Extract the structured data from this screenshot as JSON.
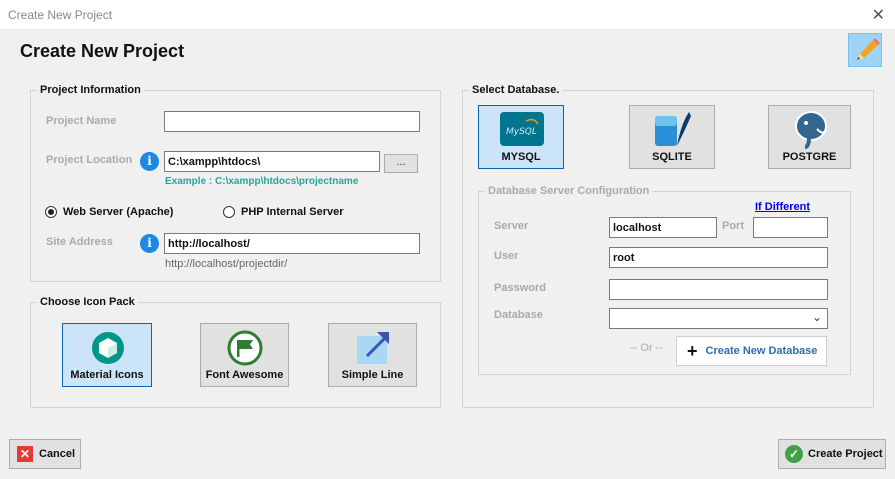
{
  "window": {
    "title": "Create New Project",
    "close_symbol": "✕"
  },
  "header": {
    "title": "Create New Project"
  },
  "project_info": {
    "legend": "Project Information",
    "name_label": "Project Name",
    "name_value": "",
    "location_label": "Project Location",
    "location_value": "C:\\xampp\\htdocs\\",
    "browse_label": "...",
    "location_example": "Example : C:\\xampp\\htdocs\\projectname",
    "info_symbol": "i",
    "server_options": [
      {
        "label": "Web Server (Apache)",
        "selected": true
      },
      {
        "label": "PHP Internal Server",
        "selected": false
      }
    ],
    "site_address_label": "Site Address",
    "site_address_value": "http://localhost/",
    "site_address_hint": "http://localhost/projectdir/"
  },
  "icon_pack": {
    "legend": "Choose Icon Pack",
    "options": [
      {
        "label": "Material Icons",
        "selected": true,
        "icon": "material-icons-icon"
      },
      {
        "label": "Font Awesome",
        "selected": false,
        "icon": "font-awesome-icon"
      },
      {
        "label": "Simple Line",
        "selected": false,
        "icon": "simple-line-icon"
      }
    ]
  },
  "database": {
    "legend": "Select Database.",
    "options": [
      {
        "label": "MYSQL",
        "selected": true,
        "logo_text": "MySQL"
      },
      {
        "label": "SQLITE",
        "selected": false
      },
      {
        "label": "POSTGRE",
        "selected": false
      }
    ],
    "config": {
      "legend": "Database Server Configuration",
      "if_different_link": "If Different",
      "server_label": "Server",
      "server_value": "localhost",
      "port_label": "Port",
      "port_value": "",
      "user_label": "User",
      "user_value": "root",
      "password_label": "Password",
      "password_value": "",
      "database_label": "Database",
      "database_value": "",
      "or_text": "-- Or --",
      "create_db_label": "Create New Database"
    }
  },
  "footer": {
    "cancel_label": "Cancel",
    "create_label": "Create Project"
  },
  "colors": {
    "accent_blue": "#1e88e5",
    "selected_tile": "#cce4f7",
    "hint_teal": "#26a69a",
    "link_blue": "#0000ee",
    "cancel_red": "#e53935",
    "create_green": "#43a047"
  }
}
